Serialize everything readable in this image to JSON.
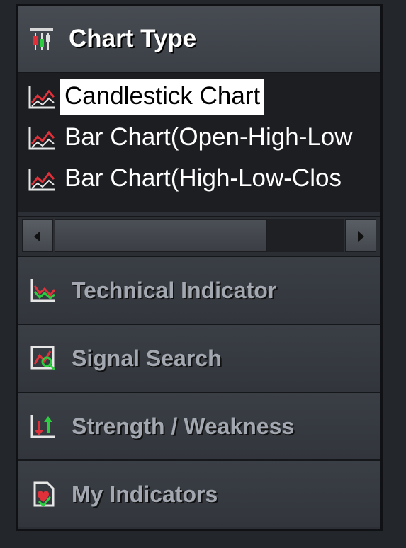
{
  "header": {
    "title": "Chart Type",
    "icon": "candlestick-icon"
  },
  "list": {
    "items": [
      {
        "label": "Candlestick Chart",
        "icon": "line-chart-icon",
        "selected": true
      },
      {
        "label": "Bar Chart(Open-High-Low",
        "icon": "line-chart-icon",
        "selected": false
      },
      {
        "label": "Bar Chart(High-Low-Clos",
        "icon": "line-chart-icon",
        "selected": false
      }
    ]
  },
  "menu": [
    {
      "label": "Technical Indicator",
      "icon": "technical-indicator-icon"
    },
    {
      "label": "Signal Search",
      "icon": "signal-search-icon"
    },
    {
      "label": "Strength / Weakness",
      "icon": "strength-weakness-icon"
    },
    {
      "label": "My Indicators",
      "icon": "my-indicators-icon"
    }
  ],
  "colors": {
    "selected_bg": "#ffffff",
    "menu_text": "#a3a8b0",
    "accent_red": "#e0303a",
    "accent_green": "#2ecc40"
  }
}
